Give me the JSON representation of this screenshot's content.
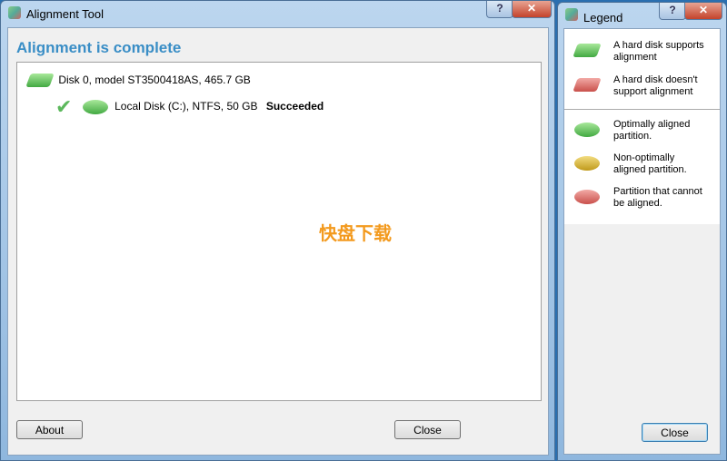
{
  "main_window": {
    "title": "Alignment Tool",
    "heading": "Alignment is complete",
    "disk": {
      "label": "Disk 0, model ST3500418AS, 465.7 GB",
      "icon": "hard-disk-green-icon"
    },
    "partition": {
      "label": "Local Disk (C:), NTFS, 50 GB",
      "status": "Succeeded",
      "icon": "partition-green-icon",
      "check_icon": "checkmark-icon"
    },
    "about_button": "About",
    "close_button": "Close",
    "help_glyph": "?",
    "close_glyph": "✕",
    "watermark": "快盘下载"
  },
  "legend_window": {
    "title": "Legend",
    "help_glyph": "?",
    "close_glyph": "✕",
    "items": [
      {
        "icon": "hard-disk-green-icon",
        "text": "A hard disk supports alignment"
      },
      {
        "icon": "hard-disk-red-icon",
        "text": "A hard disk doesn't support alignment"
      },
      {
        "icon": "partition-green-icon",
        "text": "Optimally aligned partition."
      },
      {
        "icon": "partition-yellow-icon",
        "text": "Non-optimally aligned partition."
      },
      {
        "icon": "partition-red-icon",
        "text": "Partition that cannot be aligned."
      }
    ],
    "close_button": "Close"
  },
  "colors": {
    "heading": "#3a8ec6",
    "success": "#5cb85c"
  }
}
